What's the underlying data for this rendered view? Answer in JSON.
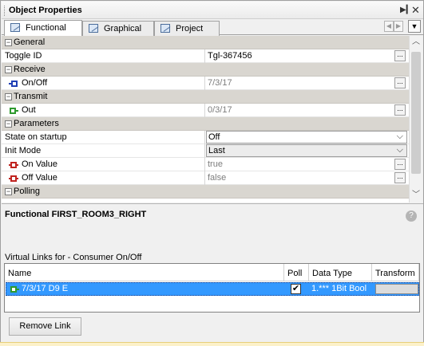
{
  "panel": {
    "title": "Object Properties"
  },
  "tabs": [
    {
      "label": "Functional",
      "active": true
    },
    {
      "label": "Graphical",
      "active": false
    },
    {
      "label": "Project",
      "active": false
    }
  ],
  "properties": {
    "general": {
      "header": "General",
      "toggle_id": {
        "name": "Toggle ID",
        "value": "Tgl-367456"
      }
    },
    "receive": {
      "header": "Receive",
      "on_off": {
        "name": "On/Off",
        "value": "7/3/17"
      }
    },
    "transmit": {
      "header": "Transmit",
      "out": {
        "name": "Out",
        "value": "0/3/17"
      }
    },
    "parameters": {
      "header": "Parameters",
      "state_on_startup": {
        "name": "State on startup",
        "value": "Off"
      },
      "init_mode": {
        "name": "Init Mode",
        "value": "Last"
      },
      "on_value": {
        "name": "On Value",
        "value": "true"
      },
      "off_value": {
        "name": "Off Value",
        "value": "false"
      }
    },
    "polling": {
      "header": "Polling"
    }
  },
  "ellipsis_label": "...",
  "description": {
    "title": "Functional FIRST_ROOM3_RIGHT"
  },
  "virtual_links": {
    "title": "Virtual Links for - Consumer On/Off",
    "columns": [
      "Name",
      "Poll",
      "Data Type",
      "Transform"
    ],
    "rows": [
      {
        "name": "7/3/17 D9  E",
        "poll": true,
        "data_type": "1.*** 1Bit Bool",
        "transform": ""
      }
    ]
  },
  "buttons": {
    "remove_link": "Remove Link"
  },
  "colors": {
    "selection": "#3399ff",
    "category_bg": "#d9d6d0",
    "receive_icon": "#1f3fb5",
    "transmit_icon": "#2e9a2e",
    "value_icon": "#c0231f"
  }
}
